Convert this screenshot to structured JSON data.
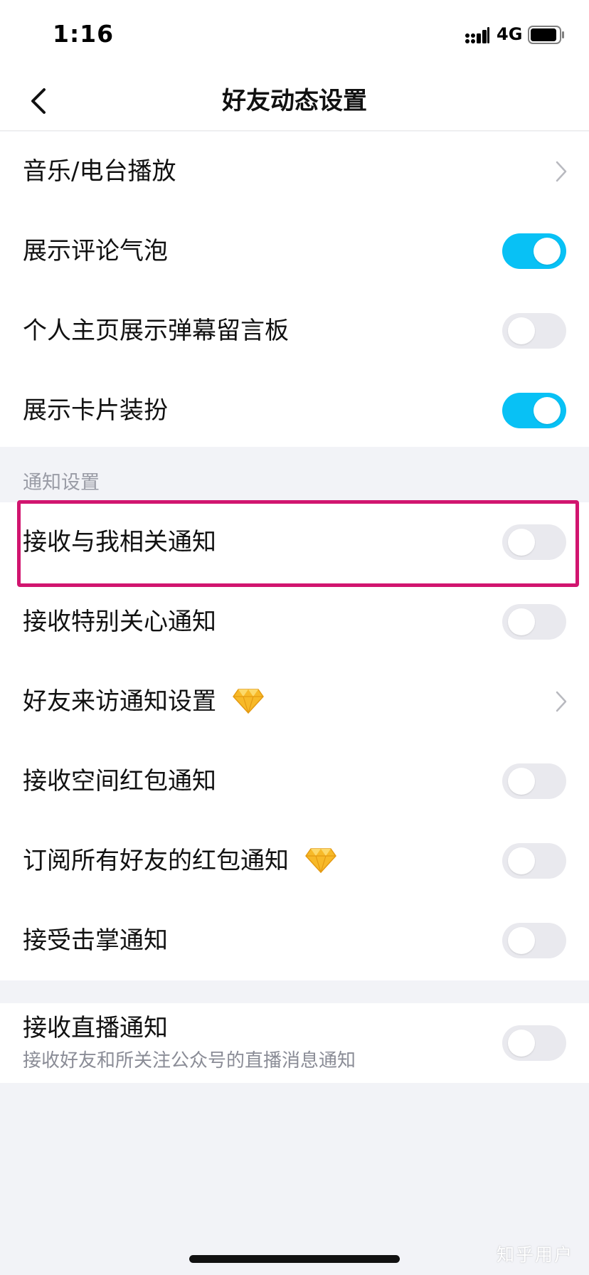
{
  "status_bar": {
    "time": "1:16",
    "network": "4G",
    "icons": [
      "signal-icon",
      "battery-icon"
    ]
  },
  "nav": {
    "title": "好友动态设置",
    "back_icon": "chevron-left-icon"
  },
  "group1": [
    {
      "label": "音乐/电台播放",
      "type": "link"
    },
    {
      "label": "展示评论气泡",
      "type": "toggle",
      "on": true
    },
    {
      "label": "个人主页展示弹幕留言板",
      "type": "toggle",
      "on": false
    },
    {
      "label": "展示卡片装扮",
      "type": "toggle",
      "on": true
    }
  ],
  "section": {
    "title": "通知设置"
  },
  "group2": [
    {
      "label": "接收与我相关通知",
      "type": "toggle",
      "on": false,
      "highlighted": true
    },
    {
      "label": "接收特别关心通知",
      "type": "toggle",
      "on": false
    },
    {
      "label": "好友来访通知设置",
      "type": "link",
      "badge": "diamond-icon"
    },
    {
      "label": "接收空间红包通知",
      "type": "toggle",
      "on": false
    },
    {
      "label": "订阅所有好友的红包通知",
      "type": "toggle",
      "on": false,
      "badge": "diamond-icon"
    },
    {
      "label": "接受击掌通知",
      "type": "toggle",
      "on": false
    }
  ],
  "group3": [
    {
      "label": "接收直播通知",
      "sublabel": "接收好友和所关注公众号的直播消息通知",
      "type": "toggle",
      "on": false
    }
  ],
  "watermark": "知乎用户",
  "colors": {
    "toggle_on": "#08c1f5",
    "toggle_off": "#e9e9ee",
    "highlight": "#d1156f",
    "diamond": "#f7b928"
  }
}
